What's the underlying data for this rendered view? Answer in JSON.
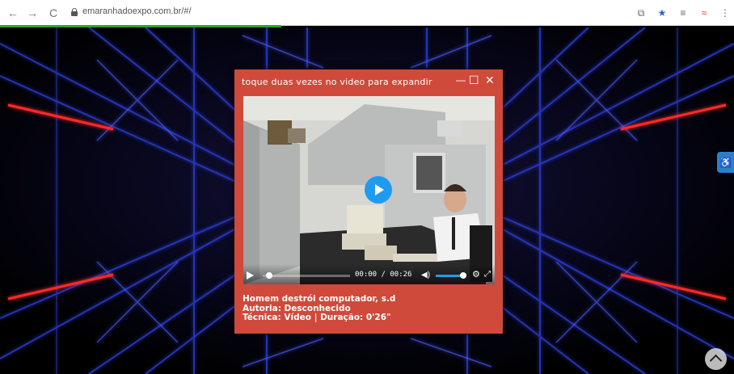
{
  "browser": {
    "url": "emaranhadoexpo.com.br/#/",
    "back_icon": "←",
    "forward_icon": "→",
    "reload_icon": "C",
    "extension_icons": [
      "translate-icon",
      "star-icon",
      "reading-list-icon",
      "extension-icon",
      "menu-icon"
    ]
  },
  "popup": {
    "title": "toque duas vezes no video para expandir",
    "minimize_label": "—",
    "maximize_label": "☐",
    "close_label": "✕",
    "video": {
      "time_display": "00:00 / 00:26",
      "progress": 0.0,
      "volume": 0.85
    },
    "caption": {
      "line1": "Homem destrói computador, s.d",
      "line2": "Autoria: Desconhecido",
      "line3": "Técnica: Vídeo | Duração: 0'26\""
    }
  },
  "colors": {
    "popup_bg": "#cf4a3a",
    "accent_blue": "#1e9bf0",
    "loading_green": "#2aa52a",
    "neon_red": "#ff2020",
    "neon_blue": "#3a4dff"
  }
}
